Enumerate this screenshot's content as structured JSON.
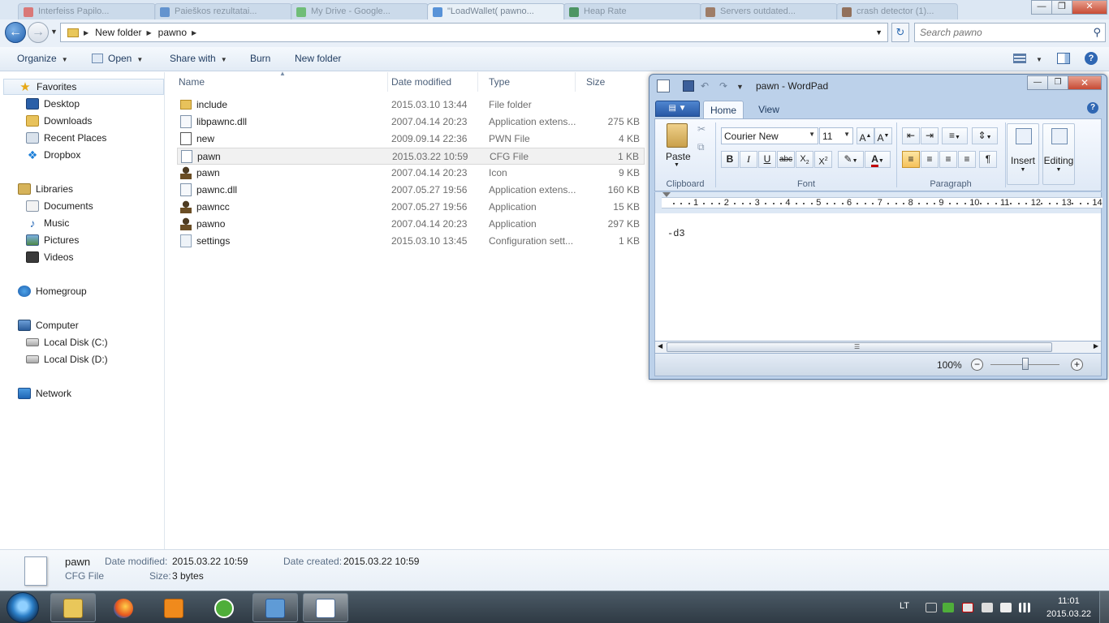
{
  "browser_tabs": [
    {
      "label": "Interfeiss Papilo..."
    },
    {
      "label": "Paieškos rezultatai..."
    },
    {
      "label": "My Drive - Google..."
    },
    {
      "label": "\"LoadWallet( pawno..."
    },
    {
      "label": "Heap Rate"
    },
    {
      "label": "Servers outdated..."
    },
    {
      "label": "crash detector (1)..."
    }
  ],
  "explorer": {
    "breadcrumb": [
      "New folder",
      "pawno"
    ],
    "search_placeholder": "Search pawno",
    "toolbar": {
      "organize": "Organize",
      "open": "Open",
      "share_with": "Share with",
      "burn": "Burn",
      "new_folder": "New folder"
    },
    "nav": {
      "favorites": "Favorites",
      "desktop": "Desktop",
      "downloads": "Downloads",
      "recent_places": "Recent Places",
      "dropbox": "Dropbox",
      "libraries": "Libraries",
      "documents": "Documents",
      "music": "Music",
      "pictures": "Pictures",
      "videos": "Videos",
      "homegroup": "Homegroup",
      "computer": "Computer",
      "local_c": "Local Disk (C:)",
      "local_d": "Local Disk (D:)",
      "network": "Network"
    },
    "columns": {
      "name": "Name",
      "date": "Date modified",
      "type": "Type",
      "size": "Size"
    },
    "files": [
      {
        "name": "include",
        "date": "2015.03.10 13:44",
        "type": "File folder",
        "size": "",
        "icon": "folder-icon"
      },
      {
        "name": "libpawnc.dll",
        "date": "2007.04.14 20:23",
        "type": "Application extens...",
        "size": "275 KB",
        "icon": "dll-file-icon"
      },
      {
        "name": "new",
        "date": "2009.09.14 22:36",
        "type": "PWN File",
        "size": "4 KB",
        "icon": "pwn-file-icon"
      },
      {
        "name": "pawn",
        "date": "2015.03.22 10:59",
        "type": "CFG File",
        "size": "1 KB",
        "icon": "cfg-file-icon"
      },
      {
        "name": "pawn",
        "date": "2007.04.14 20:23",
        "type": "Icon",
        "size": "9 KB",
        "icon": "pawn-icon"
      },
      {
        "name": "pawnc.dll",
        "date": "2007.05.27 19:56",
        "type": "Application extens...",
        "size": "160 KB",
        "icon": "dll-file-icon"
      },
      {
        "name": "pawncc",
        "date": "2007.05.27 19:56",
        "type": "Application",
        "size": "15 KB",
        "icon": "pawn-icon"
      },
      {
        "name": "pawno",
        "date": "2007.04.14 20:23",
        "type": "Application",
        "size": "297 KB",
        "icon": "pawn-icon"
      },
      {
        "name": "settings",
        "date": "2015.03.10 13:45",
        "type": "Configuration sett...",
        "size": "1 KB",
        "icon": "settings-file-icon"
      }
    ],
    "details": {
      "name": "pawn",
      "type": "CFG File",
      "date_modified_label": "Date modified:",
      "date_modified": "2015.03.22 10:59",
      "date_created_label": "Date created:",
      "date_created": "2015.03.22 10:59",
      "size_label": "Size:",
      "size": "3 bytes"
    }
  },
  "wordpad": {
    "title": "pawn - WordPad",
    "tabs": {
      "home": "Home",
      "view": "View"
    },
    "clipboard": {
      "paste": "Paste",
      "group": "Clipboard"
    },
    "font": {
      "family": "Courier New",
      "size": "11",
      "group": "Font"
    },
    "paragraph": {
      "group": "Paragraph"
    },
    "insert": "Insert",
    "editing": "Editing",
    "ruler": [
      "1",
      "2",
      "3",
      "4",
      "5",
      "6",
      "7",
      "8",
      "9",
      "10",
      "11",
      "12",
      "13",
      "14"
    ],
    "content": "-d3",
    "zoom": "100%",
    "zoom_fraction": 0.5
  },
  "taskbar": {
    "language": "LT",
    "time": "11:01",
    "date": "2015.03.22"
  }
}
